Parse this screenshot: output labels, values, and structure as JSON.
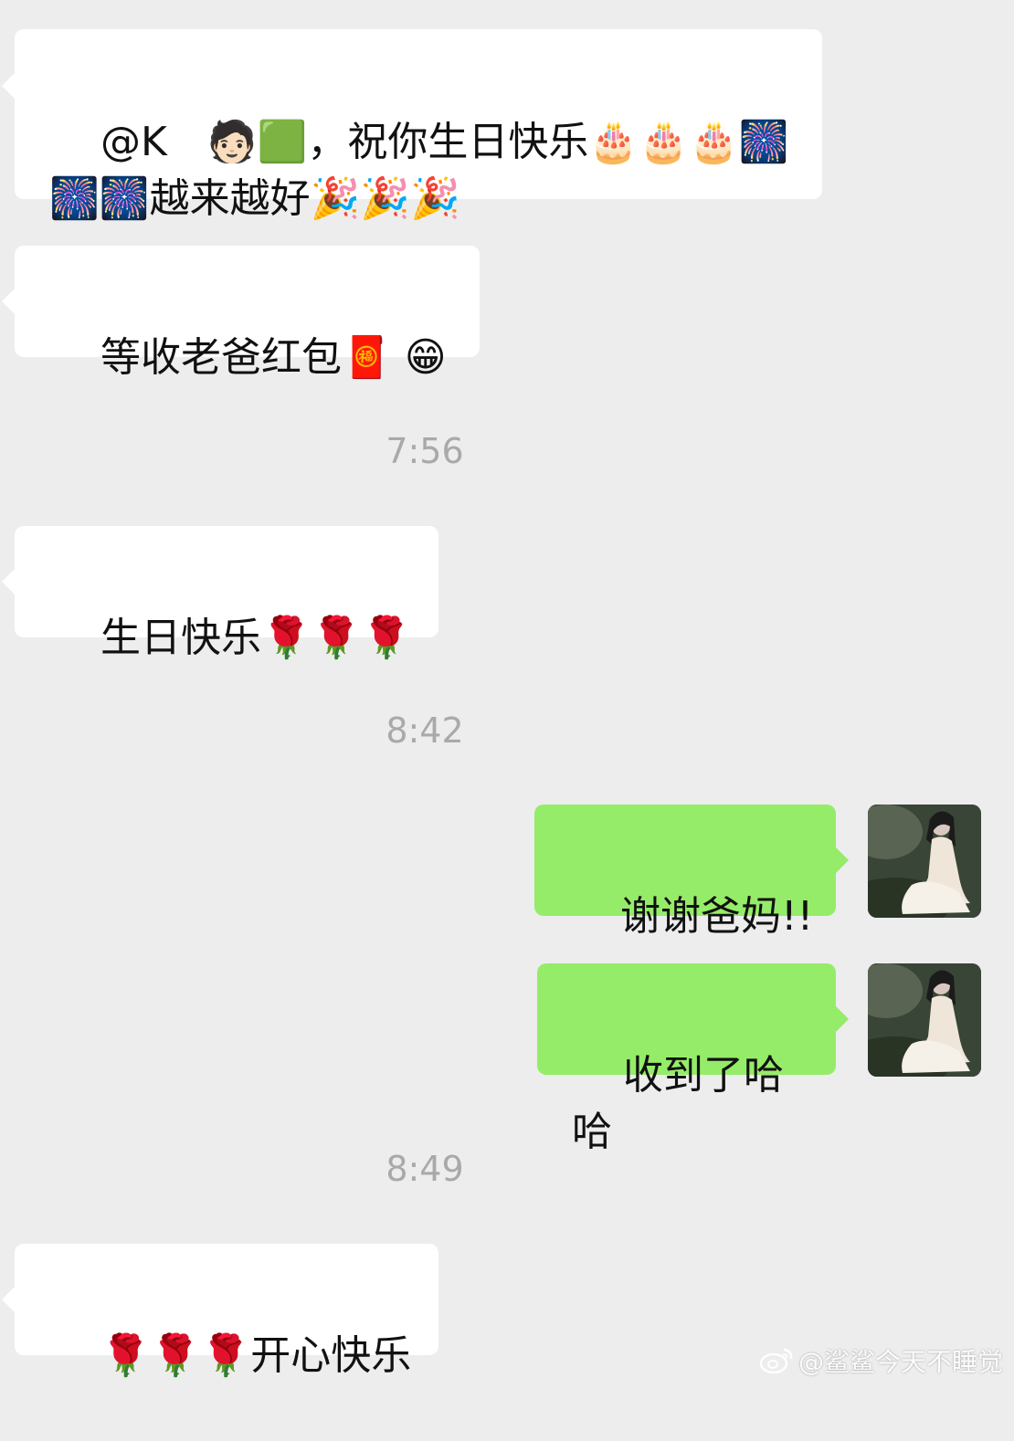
{
  "messages": [
    {
      "side": "left",
      "text": "@K　🧑🏻‍🟩，祝你生日快乐🎂🎂🎂🎆\n🎆🎆越来越好🎉🎉🎉"
    },
    {
      "side": "left",
      "text": "等收老爸红包🧧 😁"
    },
    {
      "side": "left",
      "text": "生日快乐🌹🌹🌹"
    },
    {
      "side": "right",
      "text": "谢谢爸妈!!"
    },
    {
      "side": "right",
      "text": "收到了哈哈"
    },
    {
      "side": "left",
      "text": "🌹🌹🌹开心快乐"
    }
  ],
  "timestamps": [
    "7:56",
    "8:42",
    "8:49"
  ],
  "watermark": {
    "text": "@鲨鲨今天不睡觉",
    "icon": "weibo-icon"
  },
  "colors": {
    "background": "#ededed",
    "left_bubble": "#ffffff",
    "right_bubble": "#95ec69",
    "timestamp": "#a9a9a9"
  }
}
